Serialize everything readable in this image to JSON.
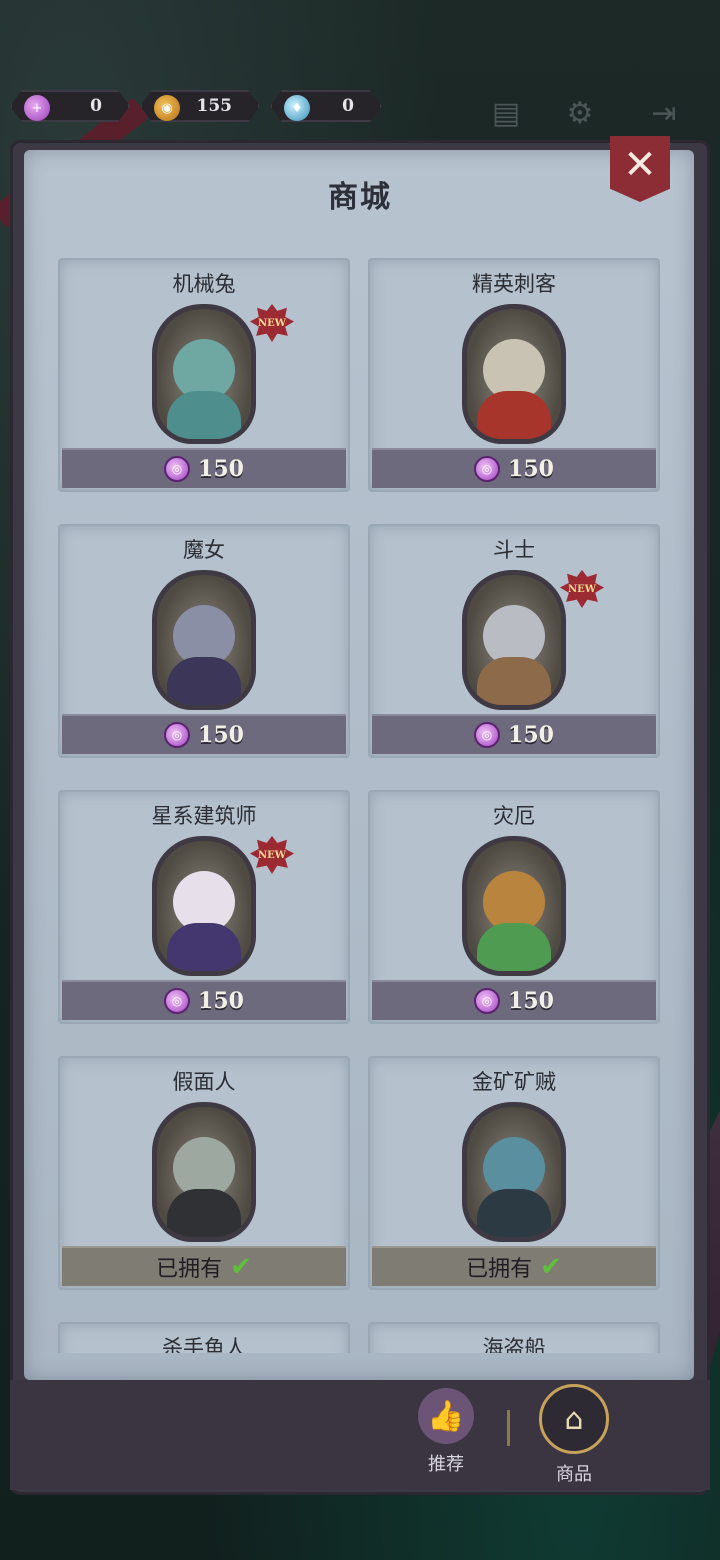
{
  "resources": [
    {
      "icon": "candy-add-icon",
      "value": "0"
    },
    {
      "icon": "pumpkin-coin-icon",
      "value": "155"
    },
    {
      "icon": "potion-icon",
      "value": "0"
    }
  ],
  "top_icons": [
    "notes-icon",
    "gear-icon",
    "exit-icon"
  ],
  "shop": {
    "title": "商城",
    "close_symbol": "✕"
  },
  "cards": [
    {
      "name": "机械兔",
      "new": true,
      "status": "price",
      "price": "150"
    },
    {
      "name": "精英刺客",
      "new": false,
      "status": "price",
      "price": "150"
    },
    {
      "name": "魔女",
      "new": false,
      "status": "price",
      "price": "150"
    },
    {
      "name": "斗士",
      "new": true,
      "status": "price",
      "price": "150"
    },
    {
      "name": "星系建筑师",
      "new": true,
      "status": "price",
      "price": "150"
    },
    {
      "name": "灾厄",
      "new": false,
      "status": "price",
      "price": "150"
    },
    {
      "name": "假面人",
      "new": false,
      "status": "owned",
      "owned_label": "已拥有"
    },
    {
      "name": "金矿矿贼",
      "new": false,
      "status": "owned",
      "owned_label": "已拥有"
    },
    {
      "name": "杀手鱼人",
      "new": false,
      "status": "partial"
    },
    {
      "name": "海盗船",
      "new": false,
      "status": "partial"
    }
  ],
  "new_badge": "NEW",
  "nav": {
    "recommend": "推荐",
    "shop": "商品"
  },
  "colors": {
    "panel_bg": "#b7c3cf",
    "price_bar": "#6c6a7c",
    "owned_bar": "#7f7c74",
    "close_button": "#8c2d36",
    "check": "#5fbf3c"
  }
}
